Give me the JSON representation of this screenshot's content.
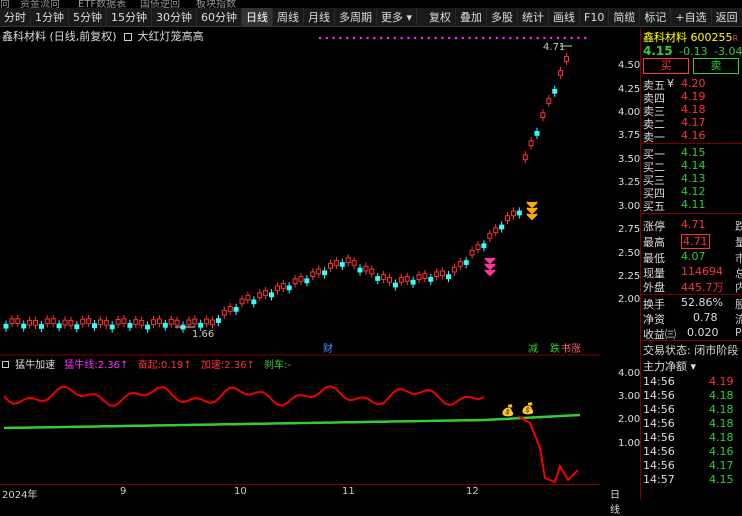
{
  "top_strip": [
    "向",
    "资金流向",
    "ETF数据表",
    "国债逆回",
    "板块指数"
  ],
  "toolbar": [
    "分时",
    "1分钟",
    "5分钟",
    "15分钟",
    "30分钟",
    "60分钟",
    "日线",
    "周线",
    "月线",
    "多周期",
    "更多",
    "复权",
    "叠加",
    "多股",
    "统计",
    "画线",
    "F10",
    "简缆",
    "标记",
    "+自选",
    "返回"
  ],
  "toolbar_selected": "日线",
  "chart": {
    "title": "鑫科材料 (日线,前复权)",
    "indicator_name": "大红灯笼高高",
    "price_axis": [
      "4.50",
      "4.25",
      "4.00",
      "3.75",
      "3.50",
      "3.25",
      "3.00",
      "2.75",
      "2.50",
      "2.25",
      "2.00"
    ],
    "high_label": "4.71",
    "low_label": "1.66",
    "markers": {
      "cai": "财",
      "jian": "减",
      "die": "跌",
      "zhang": "书涨"
    }
  },
  "indicator": {
    "name": "猛牛加速",
    "items": [
      {
        "label": "猛牛线:",
        "value": "2.36↑",
        "color": "#f3f"
      },
      {
        "label": "奋起:",
        "value": "0.19↑",
        "color": "#f33"
      },
      {
        "label": "加速:",
        "value": "2.36↑",
        "color": "#f33"
      },
      {
        "label": "刹车:",
        "value": "-",
        "color": "#3c3"
      }
    ],
    "axis": [
      "4.00",
      "3.00",
      "2.00",
      "1.00"
    ]
  },
  "xaxis": [
    "2024年",
    "9",
    "10",
    "11",
    "12",
    "日线"
  ],
  "quote": {
    "name": "鑫科材料",
    "code": "600255",
    "code_suffix": "R",
    "price": "4.15",
    "change": "-0.13",
    "pct": "-3.04%",
    "buy_btn": "买",
    "sell_btn": "卖",
    "asks": [
      {
        "label": "卖五",
        "flag": "¥",
        "price": "4.20",
        "vol": ""
      },
      {
        "label": "卖四",
        "flag": "",
        "price": "4.19",
        "vol": ""
      },
      {
        "label": "卖三",
        "flag": "",
        "price": "4.18",
        "vol": ""
      },
      {
        "label": "卖二",
        "flag": "",
        "price": "4.17",
        "vol": ""
      },
      {
        "label": "卖一",
        "flag": "",
        "price": "4.16",
        "vol": ""
      }
    ],
    "bids": [
      {
        "label": "买一",
        "price": "4.15",
        "vol": ""
      },
      {
        "label": "买二",
        "price": "4.14",
        "vol": ""
      },
      {
        "label": "买三",
        "price": "4.13",
        "vol": ""
      },
      {
        "label": "买四",
        "price": "4.12",
        "vol": ""
      },
      {
        "label": "买五",
        "price": "4.11",
        "vol": ""
      }
    ],
    "stats": [
      {
        "label": "涨停",
        "value": "4.71",
        "tail": "跌"
      },
      {
        "label": "最高",
        "value": "4.71",
        "tail": "量"
      },
      {
        "label": "最低",
        "value": "4.07",
        "tail": "市"
      },
      {
        "label": "现量",
        "value": "114694",
        "tail": "总"
      },
      {
        "label": "外盘",
        "value": "445.7万",
        "tail": "内"
      }
    ],
    "stats2": [
      {
        "label": "换手",
        "value": "52.86%",
        "tail": "股"
      },
      {
        "label": "净资",
        "value": "0.78",
        "tail": "流"
      },
      {
        "label": "收益㈢",
        "value": "0.020",
        "tail": "PE"
      }
    ],
    "trade_state": "交易状态: 闭市阶段",
    "main_flow": "主力净额",
    "ticks": [
      {
        "time": "14:56",
        "price": "4.19"
      },
      {
        "time": "14:56",
        "price": "4.18"
      },
      {
        "time": "14:56",
        "price": "4.18"
      },
      {
        "time": "14:56",
        "price": "4.18"
      },
      {
        "time": "14:56",
        "price": "4.18"
      },
      {
        "time": "14:56",
        "price": "4.16"
      },
      {
        "time": "14:56",
        "price": "4.17"
      },
      {
        "time": "14:57",
        "price": "4.15"
      }
    ]
  }
}
